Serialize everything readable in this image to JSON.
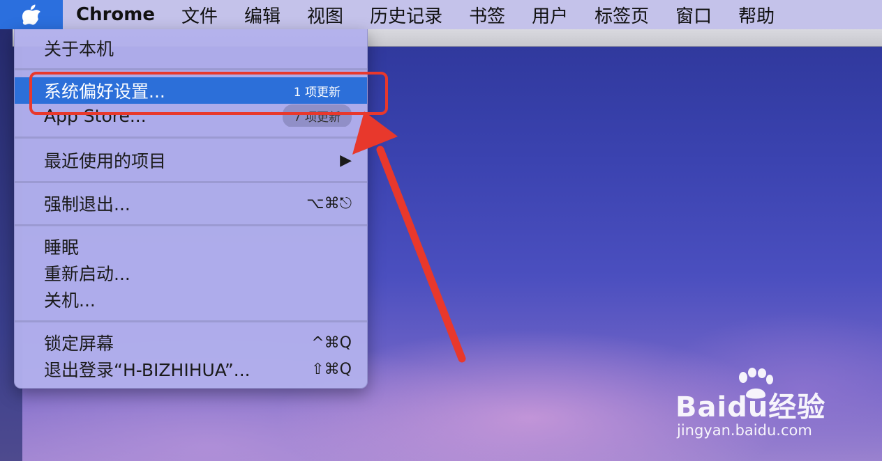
{
  "menubar": {
    "items": [
      "Chrome",
      "文件",
      "编辑",
      "视图",
      "历史记录",
      "书签",
      "用户",
      "标签页",
      "窗口",
      "帮助"
    ]
  },
  "dropdown": {
    "about": "关于本机",
    "system_prefs": {
      "label": "系统偏好设置...",
      "badge": "1 项更新"
    },
    "app_store": {
      "label": "App Store...",
      "badge": "7 项更新"
    },
    "recent": {
      "label": "最近使用的项目",
      "arrow": "▶"
    },
    "force_quit": {
      "label": "强制退出...",
      "shortcut": "⌥⌘⎋"
    },
    "sleep": "睡眠",
    "restart": "重新启动...",
    "shutdown": "关机...",
    "lock": {
      "label": "锁定屏幕",
      "shortcut": "^⌘Q"
    },
    "logout": {
      "label": "退出登录“H-BIZHIHUA”...",
      "shortcut": "⇧⌘Q"
    }
  },
  "watermark": {
    "logo": "Baidu经验",
    "url": "jingyan.baidu.com"
  },
  "colors": {
    "highlight": "#2c6fd9",
    "annotation": "#e8382c",
    "menubar": "#c4c2ea"
  },
  "icons": [
    "apple-logo-icon",
    "submenu-arrow-icon",
    "paw-icon"
  ]
}
